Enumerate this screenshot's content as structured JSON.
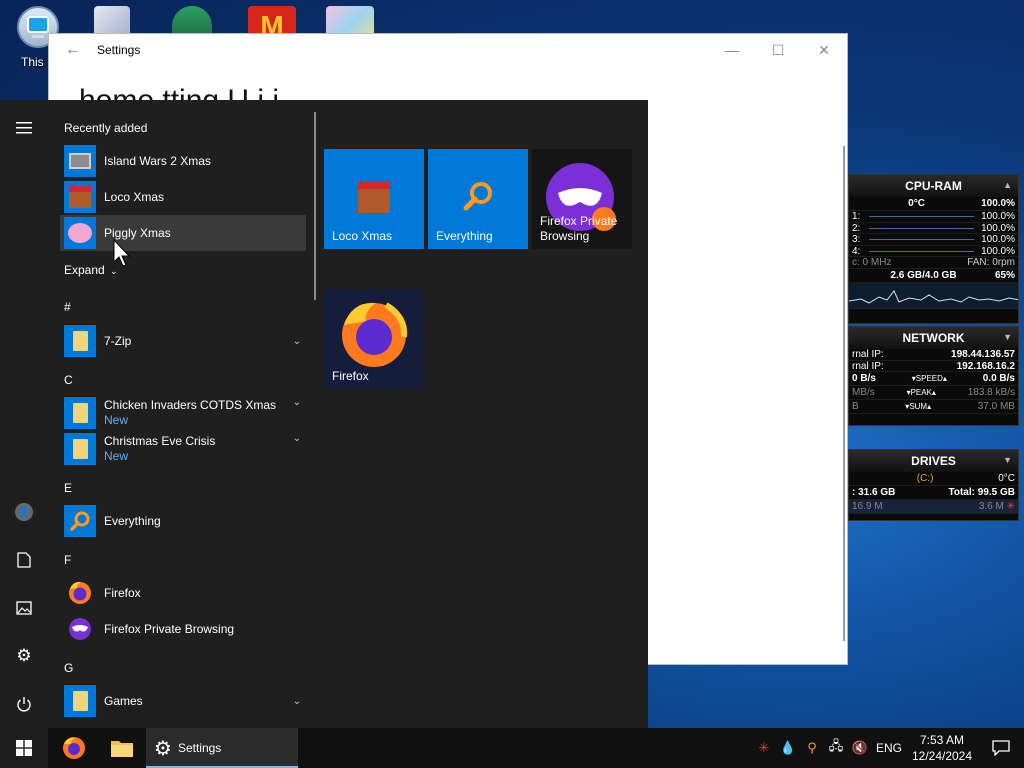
{
  "desktop": {
    "icons": [
      {
        "label": "This P",
        "icon": "this-pc-icon"
      },
      {
        "label": "",
        "icon": "app-icon"
      },
      {
        "label": "",
        "icon": "game-icon"
      },
      {
        "label": "",
        "icon": "mcdonalds-icon"
      },
      {
        "label": "",
        "icon": "game-icon"
      }
    ]
  },
  "settings_window": {
    "title": "Settings",
    "heading_partial": "home          tting    U  i i",
    "controls": {
      "minimize": "—",
      "maximize": "☐",
      "close": "✕"
    }
  },
  "cpu_ram_gadget": {
    "title": "CPU-RAM",
    "temp": "0°C",
    "total_pct": "100.0%",
    "cores": [
      {
        "label": "1:",
        "pct": "100.0%"
      },
      {
        "label": "2:",
        "pct": "100.0%"
      },
      {
        "label": "3:",
        "pct": "100.0%"
      },
      {
        "label": "4:",
        "pct": "100.0%"
      }
    ],
    "freq": "c: 0 MHz",
    "fan": "FAN: 0rpm",
    "ram": "2.6 GB/4.0 GB",
    "ram_pct": "65%"
  },
  "network_gadget": {
    "title": "NETWORK",
    "external_ip_label": "rnal IP:",
    "external_ip": "198.44.136.57",
    "internal_ip_label": "rnal IP:",
    "internal_ip": "192.168.16.2",
    "speed_left": "0 B/s",
    "speed_label": "SPEED",
    "speed_right": "0.0 B/s",
    "peak_left": "MB/s",
    "peak_label": "PEAK",
    "peak_right": "183.8 kB/s",
    "sum_left": "B",
    "sum_label": "SUM",
    "sum_right": "37.0 MB"
  },
  "drives_gadget": {
    "title": "DRIVES",
    "drive": "(C:)",
    "temp": "0°C",
    "free": ": 31.6 GB",
    "total": "Total: 99.5 GB",
    "read": "16.9 M",
    "write": "3.6 M"
  },
  "start_menu": {
    "recently_added_label": "Recently added",
    "recent": [
      {
        "name": "Island Wars 2 Xmas",
        "icon": "island-wars-icon"
      },
      {
        "name": "Loco Xmas",
        "icon": "loco-xmas-icon"
      },
      {
        "name": "Piggly Xmas",
        "icon": "piggly-xmas-icon"
      }
    ],
    "expand_label": "Expand",
    "sections": [
      {
        "letter": "#",
        "items": [
          {
            "name": "7-Zip",
            "sub": "",
            "type": "folder",
            "chevron": true
          }
        ]
      },
      {
        "letter": "C",
        "items": [
          {
            "name": "Chicken Invaders COTDS Xmas",
            "sub": "New",
            "type": "folder",
            "chevron": true
          },
          {
            "name": "Christmas Eve Crisis",
            "sub": "New",
            "type": "folder",
            "chevron": true
          }
        ]
      },
      {
        "letter": "E",
        "items": [
          {
            "name": "Everything",
            "sub": "",
            "type": "everything",
            "chevron": false
          }
        ]
      },
      {
        "letter": "F",
        "items": [
          {
            "name": "Firefox",
            "sub": "",
            "type": "firefox",
            "chevron": false
          },
          {
            "name": "Firefox Private Browsing",
            "sub": "",
            "type": "firefox-private",
            "chevron": false
          }
        ]
      },
      {
        "letter": "G",
        "items": [
          {
            "name": "Games",
            "sub": "",
            "type": "folder",
            "chevron": true
          }
        ]
      }
    ],
    "tiles": [
      {
        "label": "Loco Xmas",
        "icon": "loco-xmas-icon"
      },
      {
        "label": "Everything",
        "icon": "search-magnifier-icon"
      },
      {
        "label": "Firefox Private Browsing",
        "icon": "firefox-private-icon"
      },
      {
        "label": "Firefox",
        "icon": "firefox-icon"
      }
    ]
  },
  "taskbar": {
    "running_app_label": "Settings",
    "language": "ENG",
    "time": "7:53 AM",
    "date": "12/24/2024"
  }
}
